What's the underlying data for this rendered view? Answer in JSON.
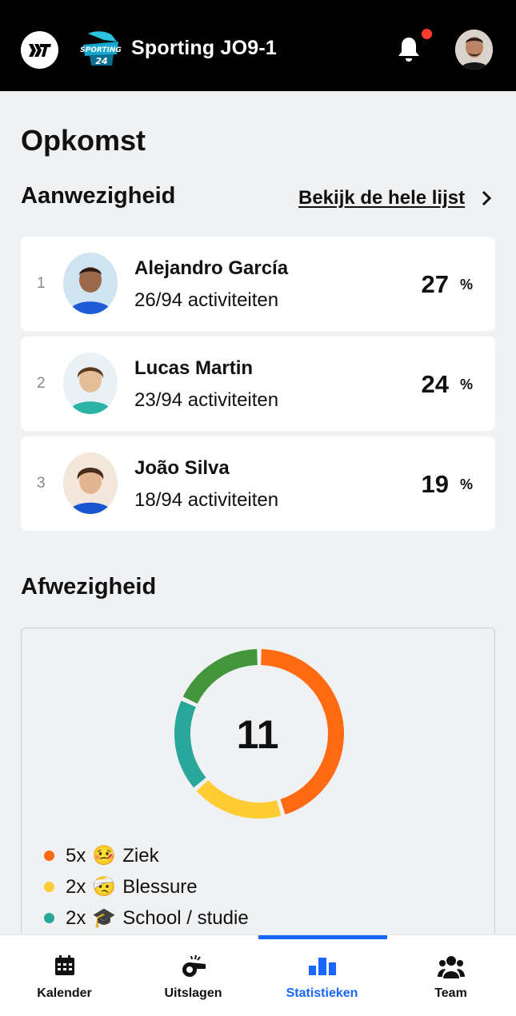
{
  "header": {
    "app_logo_icon": "mt-logo-icon",
    "club_logo_text": "SPORTING 24",
    "team_name": "Sporting JO9-1",
    "notification_icon": "bell-icon",
    "has_notification": true,
    "user_avatar": "user-avatar"
  },
  "page": {
    "title": "Opkomst"
  },
  "attendance": {
    "title": "Aanwezigheid",
    "see_all_label": "Bekijk de hele lijst",
    "players": [
      {
        "rank": "1",
        "name": "Alejandro García",
        "count": "26/94 activiteiten",
        "percent": "27",
        "unit": "%",
        "shirt": "#1f5bd6"
      },
      {
        "rank": "2",
        "name": "Lucas Martin",
        "count": "23/94 activiteiten",
        "percent": "24",
        "unit": "%",
        "shirt": "#2bb3a5"
      },
      {
        "rank": "3",
        "name": "João Silva",
        "count": "18/94 activiteiten",
        "percent": "19",
        "unit": "%",
        "shirt": "#1a55d0"
      }
    ]
  },
  "absence": {
    "title": "Afwezigheid",
    "total": "11",
    "segments": [
      {
        "count": 5,
        "label": "5x",
        "emoji": "🤒",
        "reason": "Ziek",
        "color": "#ff6a13"
      },
      {
        "count": 2,
        "label": "2x",
        "emoji": "🤕",
        "reason": "Blessure",
        "color": "#ffcc33"
      },
      {
        "count": 2,
        "label": "2x",
        "emoji": "🎓",
        "reason": "School / studie",
        "color": "#2aa79b"
      },
      {
        "count": 2,
        "label": "",
        "emoji": "",
        "reason": "",
        "color": "#43963b"
      }
    ]
  },
  "nav": {
    "items": [
      {
        "label": "Kalender",
        "icon": "calendar-icon"
      },
      {
        "label": "Uitslagen",
        "icon": "whistle-icon"
      },
      {
        "label": "Statistieken",
        "icon": "bar-chart-icon",
        "active": true
      },
      {
        "label": "Team",
        "icon": "team-icon"
      }
    ]
  }
}
